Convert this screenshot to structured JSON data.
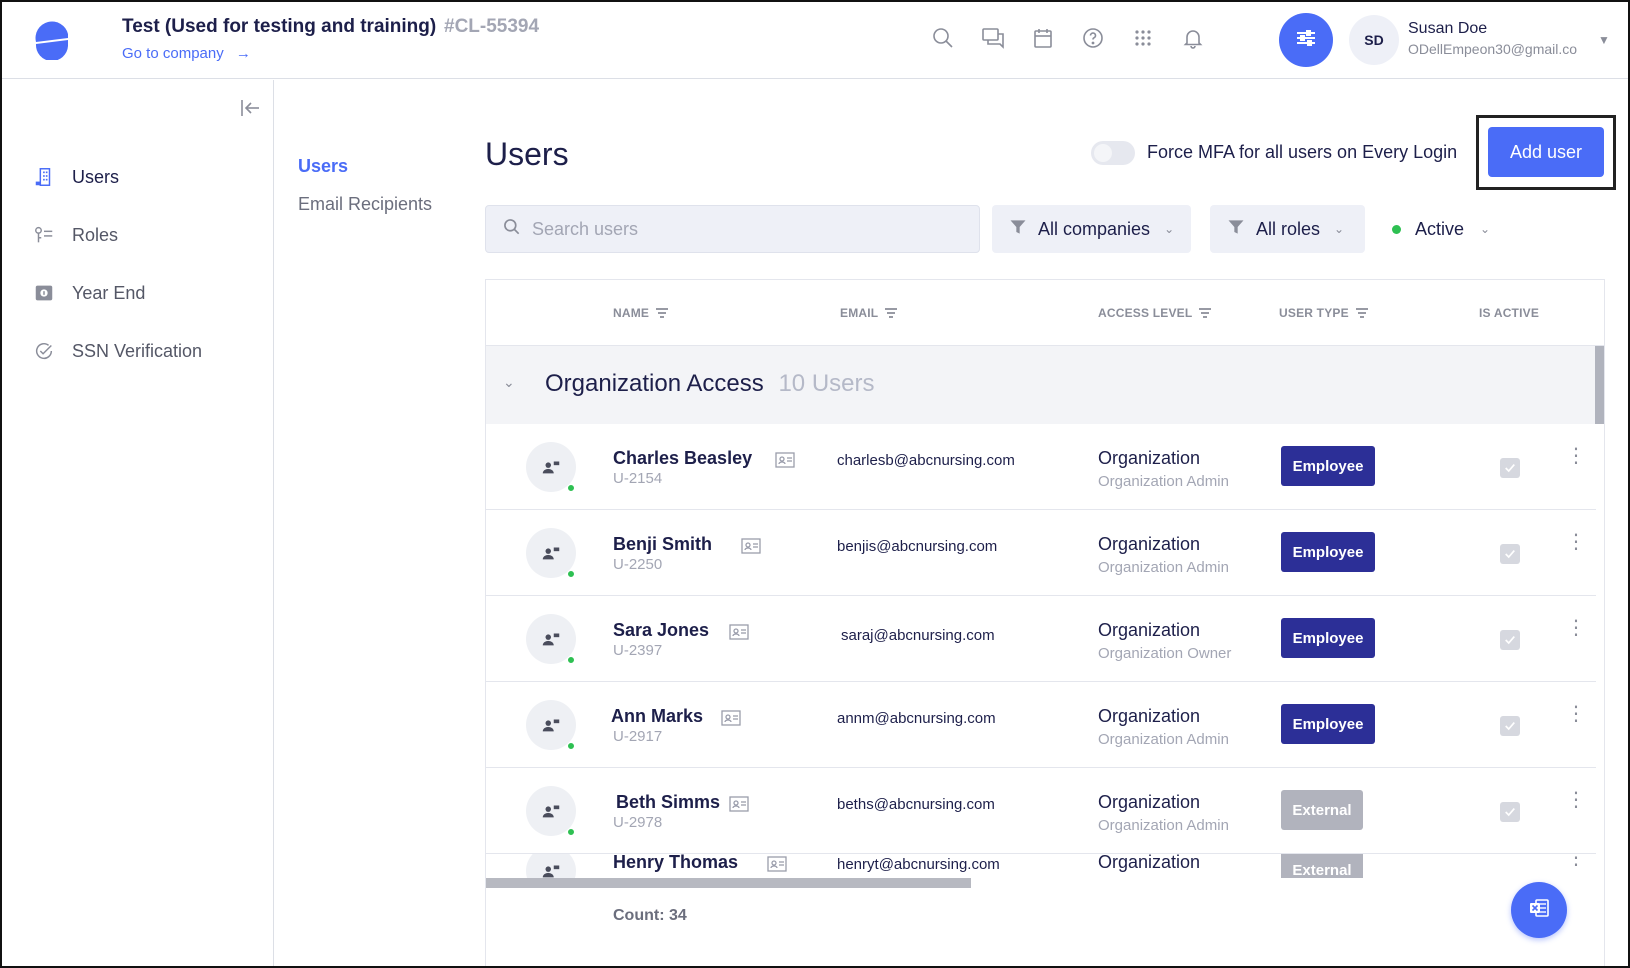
{
  "header": {
    "company_title": "Test (Used for testing and training)",
    "company_code": "#CL-55394",
    "goto_label": "Go to company",
    "goto_arrow": "→",
    "icons": [
      "search-icon",
      "chat-icon",
      "calendar-icon",
      "help-icon",
      "apps-icon",
      "bell-icon",
      "settings-sliders-icon"
    ],
    "user": {
      "initials": "SD",
      "name": "Susan Doe",
      "email": "ODellEmpeon30@gmail.co"
    }
  },
  "sidebar": {
    "items": [
      {
        "label": "Users",
        "icon": "building-icon",
        "active": true
      },
      {
        "label": "Roles",
        "icon": "key-list-icon",
        "active": false
      },
      {
        "label": "Year End",
        "icon": "year-end-icon",
        "active": false
      },
      {
        "label": "SSN Verification",
        "icon": "check-circle-icon",
        "active": false
      }
    ]
  },
  "subnav": {
    "users": "Users",
    "email_recipients": "Email Recipients"
  },
  "main": {
    "title": "Users",
    "mfa_label": "Force MFA for all users on Every Login",
    "mfa_enabled": false,
    "add_user": "Add user",
    "search_placeholder": "Search users",
    "filters": {
      "companies": "All companies",
      "roles": "All roles",
      "status": "Active"
    }
  },
  "table": {
    "headers": {
      "name": "NAME",
      "email": "EMAIL",
      "access": "ACCESS LEVEL",
      "user_type": "USER TYPE",
      "is_active": "IS ACTIVE"
    },
    "group": {
      "title": "Organization Access",
      "count": "10 Users"
    },
    "rows": [
      {
        "name": "Charles Beasley",
        "id": "U-2154",
        "email": "charlesb@abcnursing.com",
        "access": "Organization",
        "role": "Organization Admin",
        "type": "Employee",
        "active": true
      },
      {
        "name": "Benji Smith",
        "id": "U-2250",
        "email": "benjis@abcnursing.com",
        "access": "Organization",
        "role": "Organization Admin",
        "type": "Employee",
        "active": true
      },
      {
        "name": "Sara Jones",
        "id": "U-2397",
        "email": "saraj@abcnursing.com",
        "access": "Organization",
        "role": "Organization Owner",
        "type": "Employee",
        "active": true
      },
      {
        "name": "Ann Marks",
        "id": "U-2917",
        "email": "annm@abcnursing.com",
        "access": "Organization",
        "role": "Organization Admin",
        "type": "Employee",
        "active": true
      },
      {
        "name": "Beth Simms",
        "id": "U-2978",
        "email": "beths@abcnursing.com",
        "access": "Organization",
        "role": "Organization Admin",
        "type": "External",
        "active": true
      },
      {
        "name": "Henry Thomas",
        "id": "",
        "email": "henryt@abcnursing.com",
        "access": "Organization",
        "role": "",
        "type": "External",
        "active": true
      }
    ],
    "count_label": "Count: 34"
  },
  "colors": {
    "accent": "#4a6cf7",
    "navy": "#1d1f4a",
    "employee_badge": "#2c2f97",
    "external_badge": "#b1b3bd",
    "online": "#2ec052"
  }
}
